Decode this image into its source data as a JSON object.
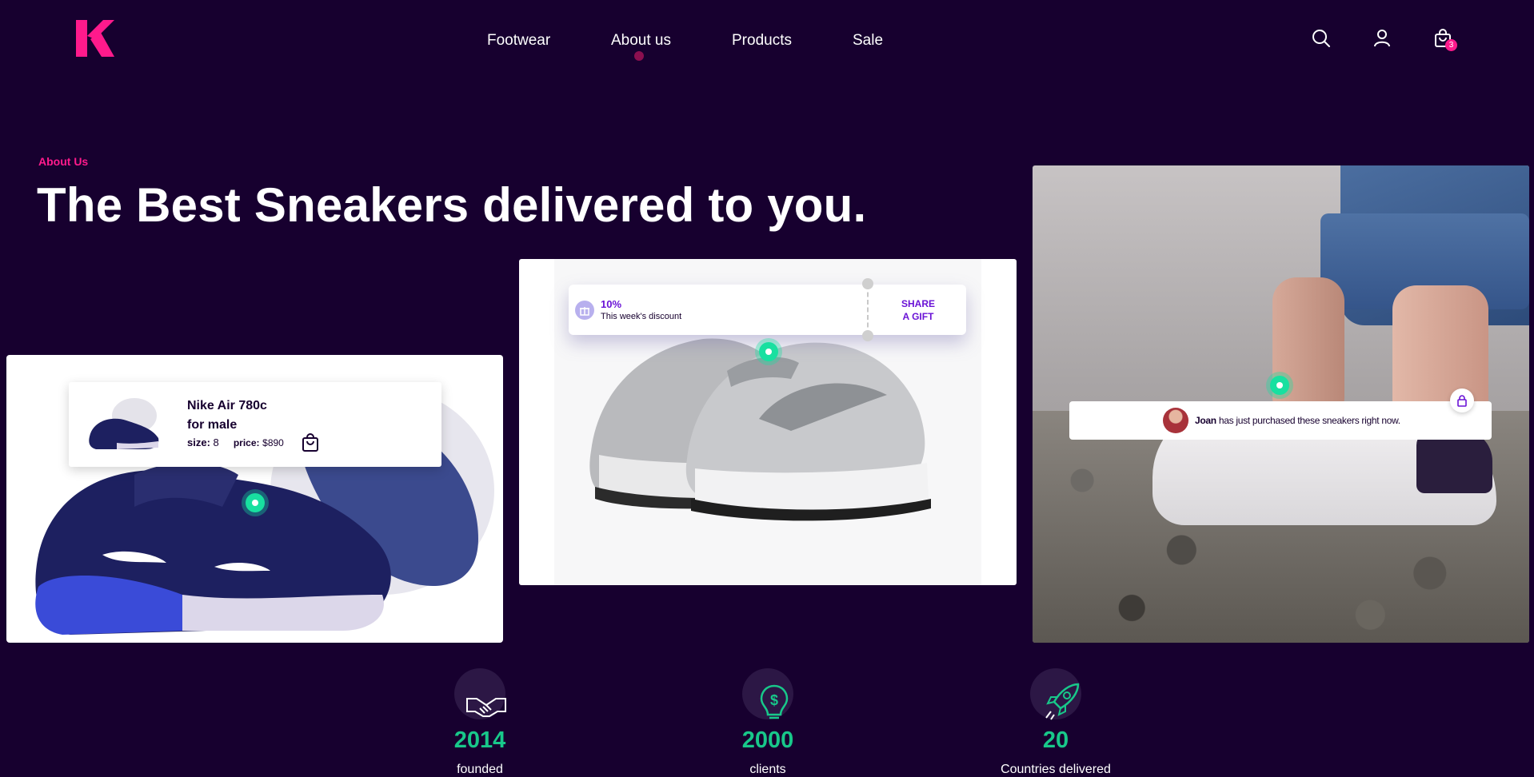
{
  "header": {
    "nav": [
      "Footwear",
      "About us",
      "Products",
      "Sale"
    ],
    "cart_count": "3"
  },
  "hero": {
    "eyebrow": "About Us",
    "headline": "The Best Sneakers delivered to you."
  },
  "product_popup": {
    "name": "Nike Air 780c",
    "gender": "for male",
    "size_label": "size:",
    "size_value": "8",
    "price_label": "price:",
    "price_value": "$890"
  },
  "discount_popup": {
    "percent": "10%",
    "subtitle": "This week's discount",
    "share_line1": "SHARE",
    "share_line2": "A GIFT"
  },
  "purchase_popup": {
    "name": "Joan",
    "message": "has just purchased these sneakers right now."
  },
  "stats": [
    {
      "icon": "handshake-icon",
      "value": "2014",
      "label": "founded"
    },
    {
      "icon": "dollar-bulb-icon",
      "value": "2000",
      "label": "clients"
    },
    {
      "icon": "rocket-icon",
      "value": "20",
      "label": "Countries delivered"
    }
  ],
  "colors": {
    "background": "#17002f",
    "accent_pink": "#ff1a8c",
    "accent_green": "#18c88a",
    "accent_purple": "#6a13d6"
  }
}
